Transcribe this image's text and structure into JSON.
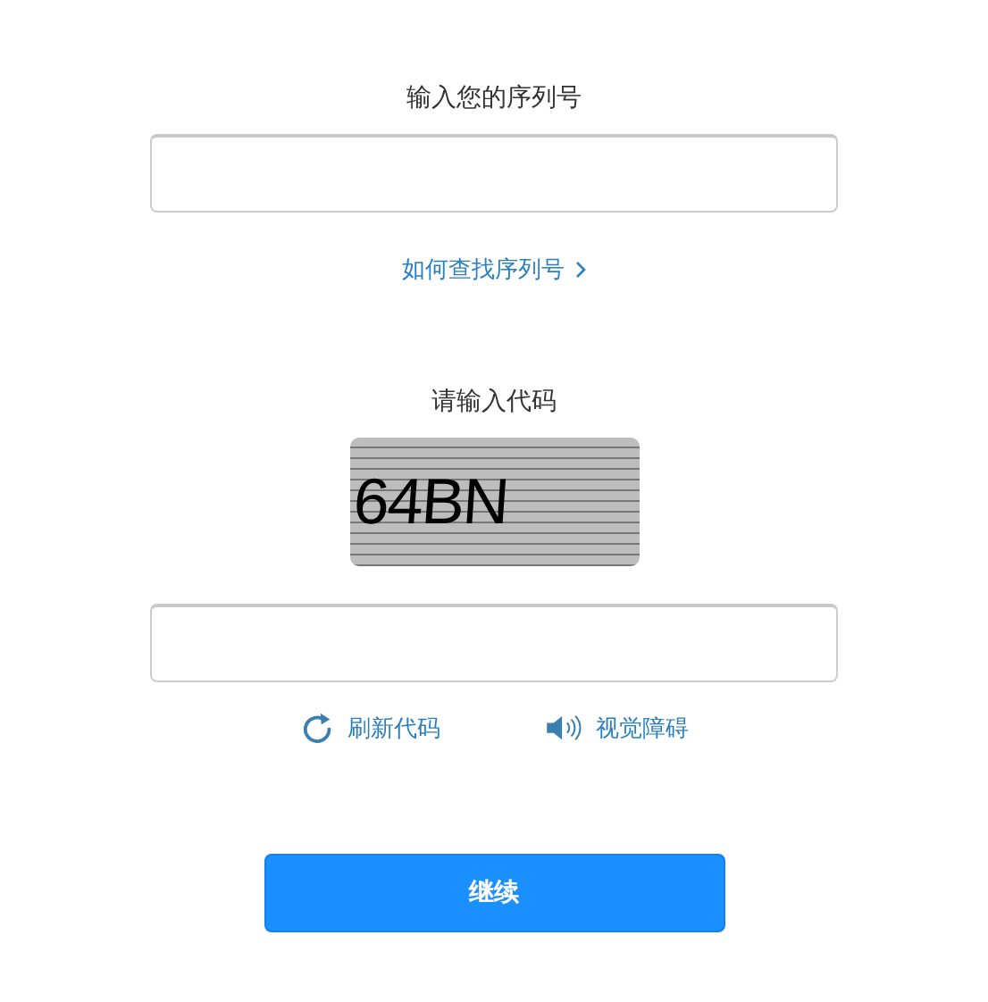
{
  "serial": {
    "label": "输入您的序列号"
  },
  "help_link": {
    "label": "如何查找序列号"
  },
  "captcha": {
    "label": "请输入代码",
    "text": "64BN"
  },
  "actions": [
    {
      "kind": "refresh",
      "label": "刷新代码"
    },
    {
      "kind": "audio",
      "label": "视觉障碍"
    }
  ],
  "continue_button": {
    "label": "继续"
  }
}
